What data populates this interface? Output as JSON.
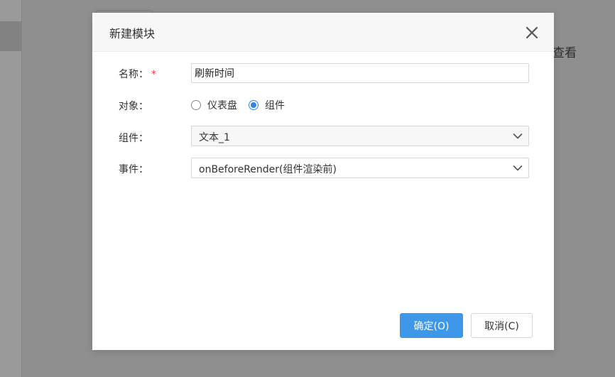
{
  "background": {
    "partial_text": "查看"
  },
  "dialog": {
    "title": "新建模块",
    "close_icon": "close-icon",
    "form": {
      "name": {
        "label": "名称：",
        "required_mark": "*",
        "value": "刷新时间"
      },
      "target": {
        "label": "对象：",
        "options": [
          {
            "label": "仪表盘",
            "checked": false
          },
          {
            "label": "组件",
            "checked": true
          }
        ]
      },
      "component": {
        "label": "组件：",
        "selected": "文本_1"
      },
      "event": {
        "label": "事件：",
        "selected": "onBeforeRender(组件渲染前)"
      }
    },
    "buttons": {
      "confirm_label": "确定(O)",
      "cancel_label": "取消(C)"
    }
  },
  "colors": {
    "accent": "#3e97e8",
    "required": "#e23c3c",
    "overlay": "#8f8f8f"
  }
}
